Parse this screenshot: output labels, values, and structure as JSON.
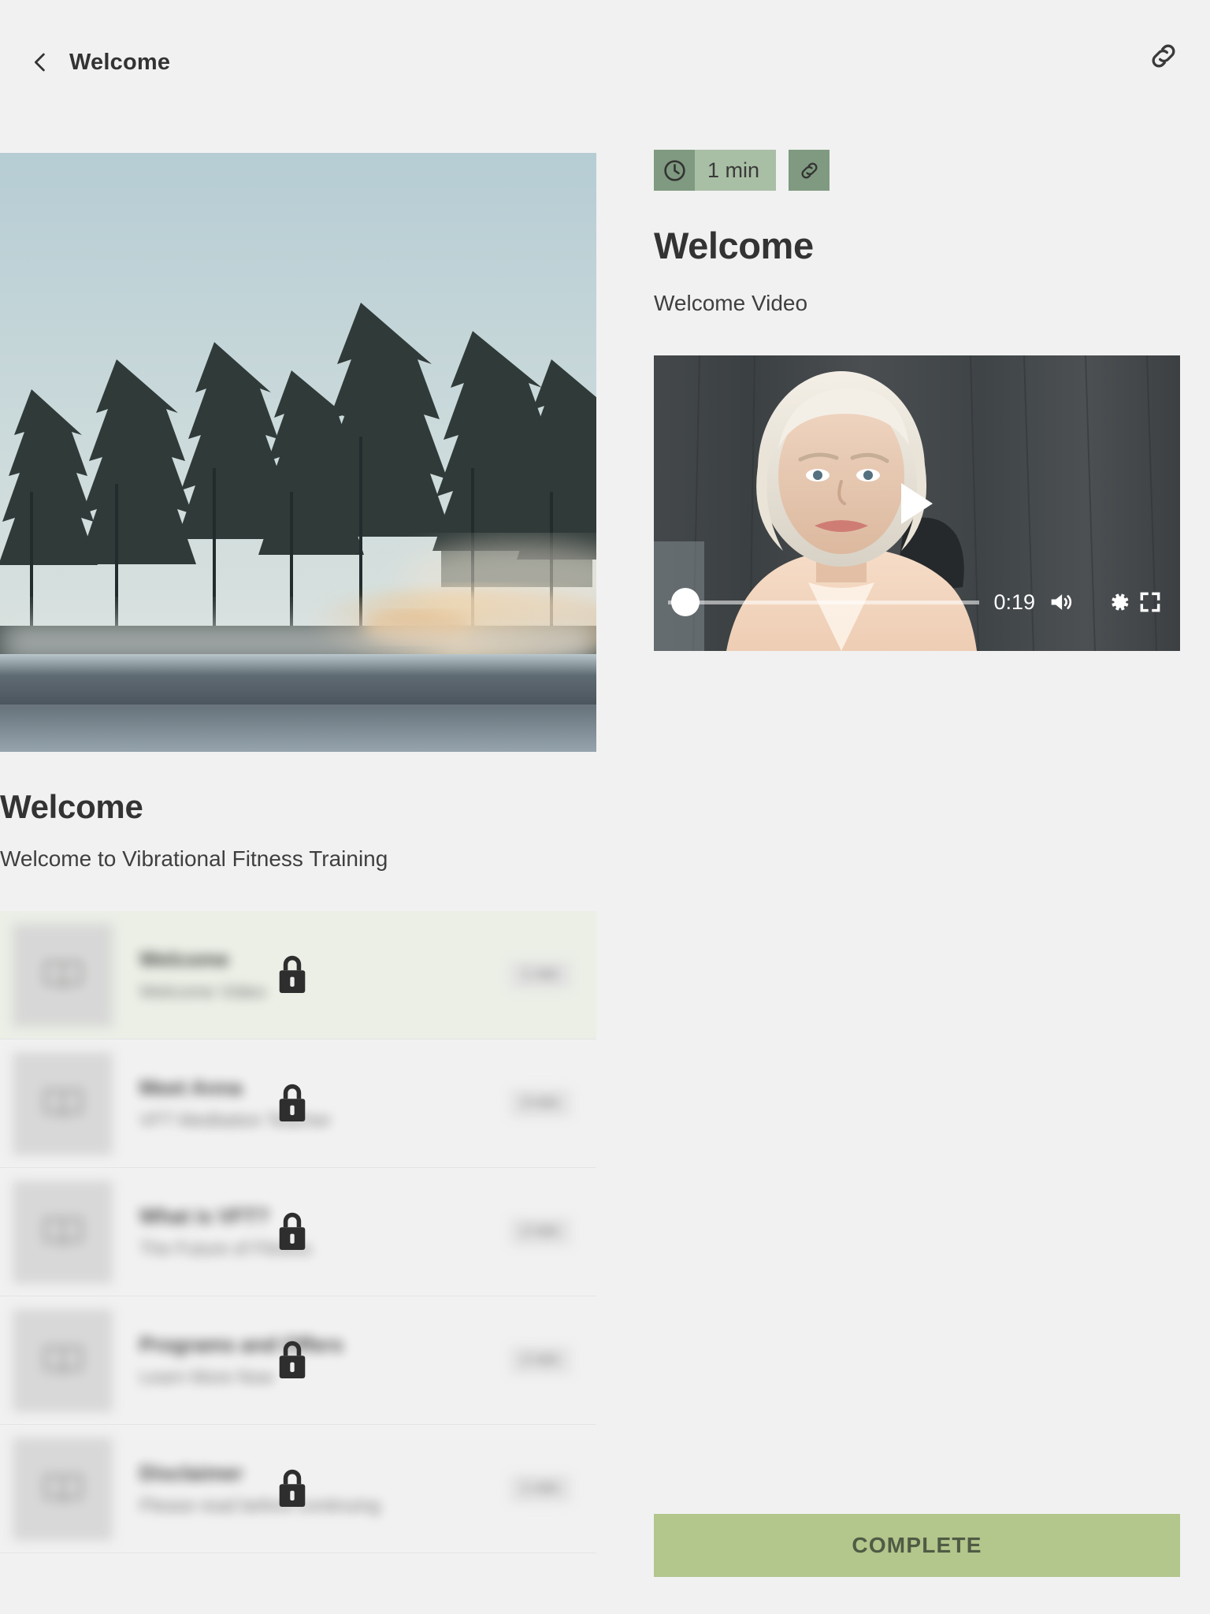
{
  "topbar": {
    "back_icon": "chevron-left-icon",
    "title": "Welcome",
    "link_icon": "link-icon"
  },
  "hero": {
    "alt": "Misty lake at dawn with pine forest reflected in still water"
  },
  "left": {
    "heading": "Welcome",
    "subheading": "Welcome to Vibrational Fitness Training",
    "lessons": [
      {
        "title": "Welcome",
        "description": "Welcome Video",
        "duration": "1 min",
        "locked": true,
        "active": true,
        "thumb_icon": "book-icon",
        "lock_icon": "lock-icon"
      },
      {
        "title": "Meet Anna",
        "description": "VFT Meditation Teacher",
        "duration": "3 min",
        "locked": true,
        "active": false,
        "thumb_icon": "book-icon",
        "lock_icon": "lock-icon"
      },
      {
        "title": "What is VFT?",
        "description": "The Future of Fitness",
        "duration": "2 min",
        "locked": true,
        "active": false,
        "thumb_icon": "book-icon",
        "lock_icon": "lock-icon"
      },
      {
        "title": "Programs and Offers",
        "description": "Learn More Now",
        "duration": "2 min",
        "locked": true,
        "active": false,
        "thumb_icon": "book-icon",
        "lock_icon": "lock-icon"
      },
      {
        "title": "Disclaimer",
        "description": "Please read before continuing",
        "duration": "1 min",
        "locked": true,
        "active": false,
        "thumb_icon": "book-icon",
        "lock_icon": "lock-icon"
      }
    ]
  },
  "right": {
    "duration_badge": {
      "icon": "clock-icon",
      "label": "1 min"
    },
    "share_link_icon": "link-icon",
    "title": "Welcome",
    "subtitle": "Welcome Video",
    "video": {
      "alt": "Woman with white hair speaking to camera in front of a grey curtain",
      "play_icon": "play-icon",
      "time": "0:19",
      "volume_icon": "volume-high-icon",
      "settings_icon": "gear-icon",
      "fullscreen_icon": "fullscreen-icon",
      "progress_percent": 0
    },
    "complete_label": "COMPLETE"
  },
  "colors": {
    "page_background": "#f1f1f1",
    "badge_dark_green": "#7f9a80",
    "badge_light_green": "#a9bfa5",
    "complete_button": "#b3c68c",
    "complete_button_text": "#4f5b44",
    "active_row": "#ebefe6",
    "heading_text": "#333333"
  }
}
